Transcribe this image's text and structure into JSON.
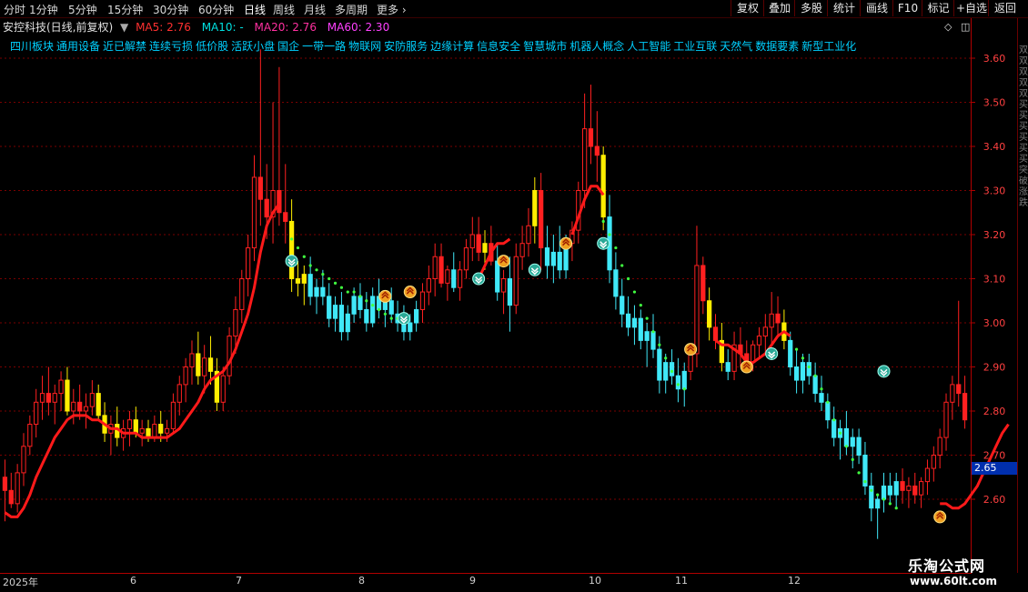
{
  "periods": [
    "分时",
    "1分钟",
    "5分钟",
    "15分钟",
    "30分钟",
    "60分钟",
    "日线",
    "周线",
    "月线",
    "多周期",
    "更多"
  ],
  "active_period": "日线",
  "toolbar": [
    "复权",
    "叠加",
    "多股",
    "统计",
    "画线",
    "F10",
    "标记",
    "+自选",
    "返回"
  ],
  "info": {
    "stock": "安控科技(日线,前复权)",
    "ma5_label": "MA5: 2.76",
    "ma10_label": "MA10: -",
    "ma20_label": "MA20: 2.76",
    "ma60_label": "MA60: 2.30",
    "colors": {
      "ma5": "#ff3030",
      "ma10": "#00e0e0",
      "ma20": "#ff30a0",
      "ma60": "#ff40ff"
    }
  },
  "concepts": [
    "四川板块",
    "通用设备",
    "近已解禁",
    "连续亏损",
    "低价股",
    "活跃小盘",
    "国企",
    "一带一路",
    "物联网",
    "安防服务",
    "边缘计算",
    "信息安全",
    "智慧城市",
    "机器人概念",
    "人工智能",
    "工业互联",
    "天然气",
    "数据要素",
    "新型工业化"
  ],
  "y_ticks": [
    "3.60",
    "3.50",
    "3.40",
    "3.30",
    "3.20",
    "3.10",
    "3.00",
    "2.90",
    "2.80",
    "2.70",
    "2.60"
  ],
  "current_price": "2.65",
  "dates": [
    "2025年",
    "6",
    "7",
    "8",
    "9",
    "10",
    "11",
    "12"
  ],
  "side_text": "双双双双双买买买买买买突破涨跌",
  "watermark": {
    "line1": "乐淘公式网",
    "line2": "www.60lt.com"
  },
  "chart_data": {
    "type": "candlestick",
    "ylim": [
      2.48,
      3.68
    ],
    "x_labels": [
      "2025年",
      "6",
      "7",
      "8",
      "9",
      "10",
      "11",
      "12"
    ],
    "candles": [
      [
        2.65,
        2.69,
        2.55,
        2.62,
        "r"
      ],
      [
        2.62,
        2.66,
        2.58,
        2.59,
        "r"
      ],
      [
        2.59,
        2.68,
        2.57,
        2.66,
        "r"
      ],
      [
        2.66,
        2.75,
        2.63,
        2.72,
        "r"
      ],
      [
        2.72,
        2.79,
        2.7,
        2.77,
        "r"
      ],
      [
        2.77,
        2.85,
        2.74,
        2.82,
        "r"
      ],
      [
        2.82,
        2.88,
        2.78,
        2.84,
        "r"
      ],
      [
        2.84,
        2.9,
        2.79,
        2.82,
        "r"
      ],
      [
        2.82,
        2.86,
        2.77,
        2.84,
        "r"
      ],
      [
        2.84,
        2.89,
        2.8,
        2.87,
        "r"
      ],
      [
        2.87,
        2.9,
        2.79,
        2.8,
        "y"
      ],
      [
        2.8,
        2.85,
        2.77,
        2.82,
        "r"
      ],
      [
        2.82,
        2.86,
        2.78,
        2.8,
        "r"
      ],
      [
        2.8,
        2.84,
        2.76,
        2.81,
        "r"
      ],
      [
        2.81,
        2.87,
        2.79,
        2.84,
        "r"
      ],
      [
        2.84,
        2.86,
        2.78,
        2.79,
        "y"
      ],
      [
        2.79,
        2.82,
        2.73,
        2.75,
        "y"
      ],
      [
        2.75,
        2.79,
        2.7,
        2.77,
        "r"
      ],
      [
        2.77,
        2.81,
        2.72,
        2.74,
        "y"
      ],
      [
        2.74,
        2.78,
        2.71,
        2.76,
        "r"
      ],
      [
        2.76,
        2.8,
        2.72,
        2.78,
        "r"
      ],
      [
        2.78,
        2.81,
        2.74,
        2.75,
        "y"
      ],
      [
        2.75,
        2.78,
        2.72,
        2.76,
        "r"
      ],
      [
        2.76,
        2.78,
        2.73,
        2.74,
        "y"
      ],
      [
        2.74,
        2.79,
        2.73,
        2.77,
        "r"
      ],
      [
        2.77,
        2.8,
        2.73,
        2.75,
        "y"
      ],
      [
        2.75,
        2.78,
        2.73,
        2.76,
        "r"
      ],
      [
        2.76,
        2.84,
        2.75,
        2.82,
        "r"
      ],
      [
        2.82,
        2.88,
        2.79,
        2.86,
        "r"
      ],
      [
        2.86,
        2.92,
        2.82,
        2.9,
        "r"
      ],
      [
        2.9,
        2.96,
        2.86,
        2.93,
        "r"
      ],
      [
        2.93,
        2.98,
        2.86,
        2.88,
        "y"
      ],
      [
        2.88,
        2.95,
        2.84,
        2.92,
        "r"
      ],
      [
        2.92,
        2.97,
        2.86,
        2.89,
        "y"
      ],
      [
        2.89,
        2.92,
        2.8,
        2.82,
        "y"
      ],
      [
        2.82,
        2.9,
        2.8,
        2.88,
        "r"
      ],
      [
        2.88,
        2.99,
        2.86,
        2.97,
        "r"
      ],
      [
        2.97,
        3.06,
        2.93,
        3.03,
        "r"
      ],
      [
        3.03,
        3.12,
        3.0,
        3.1,
        "r"
      ],
      [
        3.1,
        3.2,
        3.06,
        3.17,
        "r"
      ],
      [
        3.17,
        3.38,
        3.14,
        3.33,
        "r"
      ],
      [
        3.33,
        3.62,
        3.22,
        3.28,
        "r"
      ],
      [
        3.28,
        3.36,
        3.19,
        3.24,
        "r"
      ],
      [
        3.24,
        3.5,
        3.18,
        3.3,
        "r"
      ],
      [
        3.3,
        3.58,
        3.22,
        3.25,
        "r"
      ],
      [
        3.25,
        3.36,
        3.18,
        3.23,
        "r"
      ],
      [
        3.23,
        3.28,
        3.07,
        3.1,
        "y"
      ],
      [
        3.1,
        3.14,
        3.06,
        3.09,
        "y"
      ],
      [
        3.09,
        3.13,
        3.04,
        3.11,
        "y"
      ],
      [
        3.11,
        3.15,
        3.04,
        3.06,
        "c"
      ],
      [
        3.06,
        3.1,
        3.02,
        3.08,
        "c"
      ],
      [
        3.08,
        3.12,
        3.04,
        3.06,
        "c"
      ],
      [
        3.06,
        3.09,
        2.99,
        3.01,
        "c"
      ],
      [
        3.01,
        3.06,
        2.98,
        3.04,
        "c"
      ],
      [
        3.04,
        3.07,
        2.96,
        2.98,
        "c"
      ],
      [
        2.98,
        3.04,
        2.96,
        3.02,
        "c"
      ],
      [
        3.02,
        3.08,
        3.0,
        3.06,
        "c"
      ],
      [
        3.06,
        3.09,
        3.01,
        3.03,
        "c"
      ],
      [
        3.03,
        3.07,
        2.98,
        3.0,
        "c"
      ],
      [
        3.0,
        3.08,
        2.99,
        3.06,
        "c"
      ],
      [
        3.06,
        3.1,
        3.01,
        3.03,
        "c"
      ],
      [
        3.03,
        3.07,
        2.99,
        3.05,
        "c"
      ],
      [
        3.05,
        3.08,
        3.0,
        3.02,
        "c"
      ],
      [
        3.02,
        3.05,
        2.98,
        3.0,
        "c"
      ],
      [
        3.0,
        3.04,
        2.96,
        2.98,
        "c"
      ],
      [
        2.98,
        3.02,
        2.96,
        3.0,
        "c"
      ],
      [
        3.0,
        3.05,
        2.98,
        3.03,
        "c"
      ],
      [
        3.03,
        3.09,
        3.0,
        3.07,
        "r"
      ],
      [
        3.07,
        3.13,
        3.04,
        3.1,
        "r"
      ],
      [
        3.1,
        3.18,
        3.06,
        3.15,
        "r"
      ],
      [
        3.15,
        3.18,
        3.08,
        3.09,
        "r"
      ],
      [
        3.09,
        3.13,
        3.05,
        3.12,
        "r"
      ],
      [
        3.12,
        3.16,
        3.07,
        3.08,
        "c"
      ],
      [
        3.08,
        3.14,
        3.05,
        3.12,
        "r"
      ],
      [
        3.12,
        3.19,
        3.1,
        3.17,
        "r"
      ],
      [
        3.17,
        3.24,
        3.14,
        3.2,
        "r"
      ],
      [
        3.2,
        3.24,
        3.14,
        3.16,
        "r"
      ],
      [
        3.16,
        3.21,
        3.12,
        3.18,
        "y"
      ],
      [
        3.18,
        3.22,
        3.13,
        3.14,
        "r"
      ],
      [
        3.14,
        3.18,
        3.05,
        3.07,
        "c"
      ],
      [
        3.07,
        3.12,
        3.02,
        3.1,
        "r"
      ],
      [
        3.1,
        3.15,
        2.98,
        3.04,
        "c"
      ],
      [
        3.04,
        3.18,
        3.02,
        3.15,
        "r"
      ],
      [
        3.15,
        3.22,
        3.12,
        3.18,
        "r"
      ],
      [
        3.18,
        3.26,
        3.15,
        3.22,
        "r"
      ],
      [
        3.22,
        3.33,
        3.18,
        3.3,
        "y"
      ],
      [
        3.3,
        3.34,
        3.12,
        3.17,
        "r"
      ],
      [
        3.17,
        3.22,
        3.1,
        3.13,
        "c"
      ],
      [
        3.13,
        3.2,
        3.09,
        3.16,
        "c"
      ],
      [
        3.16,
        3.22,
        3.1,
        3.12,
        "c"
      ],
      [
        3.12,
        3.2,
        3.1,
        3.18,
        "c"
      ],
      [
        3.18,
        3.23,
        3.14,
        3.21,
        "r"
      ],
      [
        3.21,
        3.32,
        3.18,
        3.3,
        "r"
      ],
      [
        3.3,
        3.52,
        3.26,
        3.44,
        "r"
      ],
      [
        3.44,
        3.54,
        3.36,
        3.4,
        "r"
      ],
      [
        3.4,
        3.48,
        3.32,
        3.38,
        "r"
      ],
      [
        3.38,
        3.4,
        3.21,
        3.24,
        "y"
      ],
      [
        3.24,
        3.29,
        3.09,
        3.12,
        "c"
      ],
      [
        3.12,
        3.16,
        3.03,
        3.06,
        "c"
      ],
      [
        3.06,
        3.1,
        2.99,
        3.02,
        "c"
      ],
      [
        3.02,
        3.06,
        2.97,
        2.99,
        "c"
      ],
      [
        2.99,
        3.04,
        2.95,
        3.01,
        "c"
      ],
      [
        3.01,
        3.03,
        2.94,
        2.96,
        "c"
      ],
      [
        2.96,
        3.0,
        2.9,
        2.98,
        "c"
      ],
      [
        2.98,
        3.02,
        2.92,
        2.94,
        "c"
      ],
      [
        2.94,
        2.97,
        2.84,
        2.87,
        "c"
      ],
      [
        2.87,
        2.93,
        2.84,
        2.91,
        "c"
      ],
      [
        2.91,
        2.94,
        2.86,
        2.88,
        "c"
      ],
      [
        2.88,
        2.92,
        2.82,
        2.85,
        "c"
      ],
      [
        2.85,
        2.91,
        2.81,
        2.89,
        "c"
      ],
      [
        2.89,
        2.95,
        2.87,
        2.93,
        "r"
      ],
      [
        2.93,
        3.22,
        2.9,
        3.13,
        "r"
      ],
      [
        3.13,
        3.15,
        3.02,
        3.05,
        "r"
      ],
      [
        3.05,
        3.08,
        2.96,
        2.99,
        "y"
      ],
      [
        2.99,
        3.02,
        2.94,
        2.96,
        "r"
      ],
      [
        2.96,
        3.0,
        2.89,
        2.91,
        "y"
      ],
      [
        2.91,
        2.94,
        2.87,
        2.89,
        "c"
      ],
      [
        2.89,
        2.98,
        2.87,
        2.95,
        "r"
      ],
      [
        2.95,
        2.99,
        2.9,
        2.93,
        "r"
      ],
      [
        2.93,
        2.96,
        2.89,
        2.91,
        "r"
      ],
      [
        2.91,
        2.96,
        2.89,
        2.95,
        "r"
      ],
      [
        2.95,
        2.99,
        2.92,
        2.97,
        "r"
      ],
      [
        2.97,
        3.02,
        2.93,
        2.99,
        "r"
      ],
      [
        2.99,
        3.07,
        2.95,
        3.02,
        "r"
      ],
      [
        3.02,
        3.06,
        2.97,
        3.0,
        "r"
      ],
      [
        3.0,
        3.03,
        2.94,
        2.96,
        "y"
      ],
      [
        2.96,
        2.98,
        2.88,
        2.9,
        "c"
      ],
      [
        2.9,
        2.94,
        2.84,
        2.87,
        "c"
      ],
      [
        2.87,
        2.93,
        2.84,
        2.91,
        "c"
      ],
      [
        2.91,
        2.93,
        2.86,
        2.88,
        "c"
      ],
      [
        2.88,
        2.91,
        2.82,
        2.84,
        "c"
      ],
      [
        2.84,
        2.88,
        2.8,
        2.82,
        "c"
      ],
      [
        2.82,
        2.84,
        2.76,
        2.78,
        "c"
      ],
      [
        2.78,
        2.81,
        2.72,
        2.74,
        "c"
      ],
      [
        2.74,
        2.78,
        2.69,
        2.76,
        "c"
      ],
      [
        2.76,
        2.8,
        2.7,
        2.72,
        "c"
      ],
      [
        2.72,
        2.76,
        2.67,
        2.74,
        "c"
      ],
      [
        2.74,
        2.76,
        2.68,
        2.7,
        "c"
      ],
      [
        2.7,
        2.73,
        2.61,
        2.63,
        "c"
      ],
      [
        2.63,
        2.66,
        2.55,
        2.58,
        "c"
      ],
      [
        2.58,
        2.61,
        2.51,
        2.6,
        "c"
      ],
      [
        2.6,
        2.66,
        2.57,
        2.63,
        "c"
      ],
      [
        2.63,
        2.66,
        2.59,
        2.61,
        "c"
      ],
      [
        2.61,
        2.66,
        2.58,
        2.64,
        "c"
      ],
      [
        2.64,
        2.67,
        2.59,
        2.62,
        "r"
      ],
      [
        2.62,
        2.65,
        2.58,
        2.63,
        "r"
      ],
      [
        2.63,
        2.66,
        2.59,
        2.61,
        "r"
      ],
      [
        2.61,
        2.65,
        2.58,
        2.64,
        "r"
      ],
      [
        2.64,
        2.69,
        2.61,
        2.67,
        "r"
      ],
      [
        2.67,
        2.72,
        2.64,
        2.7,
        "r"
      ],
      [
        2.7,
        2.76,
        2.67,
        2.74,
        "r"
      ],
      [
        2.74,
        2.84,
        2.71,
        2.82,
        "r"
      ],
      [
        2.82,
        2.88,
        2.78,
        2.86,
        "r"
      ],
      [
        2.86,
        3.05,
        2.81,
        2.84,
        "r"
      ],
      [
        2.84,
        2.88,
        2.76,
        2.78,
        "r"
      ]
    ],
    "ma_line": {
      "color": "#ff1a1a",
      "from": 0,
      "to": 44,
      "values": [
        2.57,
        2.56,
        2.56,
        2.58,
        2.61,
        2.65,
        2.68,
        2.71,
        2.74,
        2.76,
        2.78,
        2.79,
        2.79,
        2.79,
        2.78,
        2.78,
        2.77,
        2.76,
        2.76,
        2.75,
        2.75,
        2.75,
        2.74,
        2.74,
        2.74,
        2.74,
        2.74,
        2.75,
        2.76,
        2.78,
        2.8,
        2.82,
        2.85,
        2.87,
        2.88,
        2.89,
        2.91,
        2.94,
        2.98,
        3.02,
        3.08,
        3.16,
        3.22,
        3.25,
        3.27
      ]
    },
    "ma_segments": [
      {
        "color": "#ff1a1a",
        "start": 76,
        "values": [
          3.1,
          3.13,
          3.16,
          3.18,
          3.18,
          3.19
        ]
      },
      {
        "color": "#ff1a1a",
        "start": 91,
        "values": [
          3.2,
          3.24,
          3.28,
          3.31,
          3.31,
          3.29
        ]
      },
      {
        "color": "#ff1a1a",
        "start": 114,
        "values": [
          2.96,
          2.95,
          2.95,
          2.94,
          2.93,
          2.91,
          2.91,
          2.92,
          2.93,
          2.95,
          2.97,
          2.98,
          2.97
        ]
      },
      {
        "color": "#ff1a1a",
        "start": 150,
        "values": [
          2.59,
          2.59,
          2.58,
          2.58,
          2.59,
          2.61,
          2.63,
          2.66,
          2.69,
          2.72,
          2.75,
          2.77
        ]
      }
    ],
    "dot_segments": [
      {
        "color": "#40ff40",
        "start": 46,
        "values": [
          3.19,
          3.17,
          3.15,
          3.13,
          3.12,
          3.11,
          3.1,
          3.09,
          3.08,
          3.07,
          3.07,
          3.06,
          3.05,
          3.04,
          3.03,
          3.02,
          3.01,
          3.01,
          3.0
        ]
      },
      {
        "color": "#40ff40",
        "start": 96,
        "values": [
          3.23,
          3.2,
          3.17,
          3.13,
          3.1,
          3.07,
          3.04,
          3.01,
          2.98,
          2.95,
          2.92,
          2.89,
          2.86,
          2.85
        ]
      },
      {
        "color": "#40ff40",
        "start": 127,
        "values": [
          2.94,
          2.92,
          2.9,
          2.88,
          2.85,
          2.82,
          2.78,
          2.75,
          2.72,
          2.69,
          2.66,
          2.64,
          2.62,
          2.61,
          2.6,
          2.59,
          2.58
        ]
      }
    ],
    "markers": [
      {
        "i": 46,
        "v": 3.14,
        "kind": "sell"
      },
      {
        "i": 64,
        "v": 3.01,
        "kind": "sell"
      },
      {
        "i": 76,
        "v": 3.1,
        "kind": "sell"
      },
      {
        "i": 85,
        "v": 3.12,
        "kind": "sell"
      },
      {
        "i": 96,
        "v": 3.18,
        "kind": "sell"
      },
      {
        "i": 123,
        "v": 2.93,
        "kind": "sell"
      },
      {
        "i": 141,
        "v": 2.89,
        "kind": "sell"
      },
      {
        "i": 61,
        "v": 3.06,
        "kind": "buy"
      },
      {
        "i": 65,
        "v": 3.07,
        "kind": "buy"
      },
      {
        "i": 80,
        "v": 3.14,
        "kind": "buy"
      },
      {
        "i": 90,
        "v": 3.18,
        "kind": "buy"
      },
      {
        "i": 110,
        "v": 2.94,
        "kind": "buy"
      },
      {
        "i": 119,
        "v": 2.9,
        "kind": "buy"
      },
      {
        "i": 150,
        "v": 2.56,
        "kind": "buy"
      }
    ]
  }
}
